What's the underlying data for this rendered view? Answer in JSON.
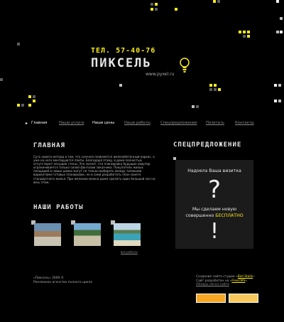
{
  "header": {
    "phone": "ТЕЛ. 57-40-76",
    "brand": "ПИКСЕЛЬ",
    "site": "www.pyxel.ru"
  },
  "nav": {
    "items": [
      {
        "label": "Главная",
        "active": true
      },
      {
        "label": "Наши услуги",
        "active": false
      },
      {
        "label": "Наши цены",
        "active": true
      },
      {
        "label": "Наши работы",
        "active": false
      },
      {
        "label": "Спецпредложение",
        "active": false
      },
      {
        "label": "Почитать",
        "active": false
      },
      {
        "label": "Контакты",
        "active": false
      }
    ]
  },
  "main": {
    "title": "ГЛАВНАЯ",
    "text": "Суть нового метода в том, что сначала появляется железобетонный каркас, а уже на него монтируются плиты. Благодаря этому, в доме полностью отсутствуют несущие стены. Это значит, что планировка будущих квартир ограничивается только силой фантазии заказчика. Покупатели жилых площадей в новых домах могут не только выбирать между типовыми вариантами готовых планировок, но и сами разработать план своего стандартного жилья. При желании можно даже сделать один большой зал на весь этаж."
  },
  "works": {
    "title": "НАШИ РАБОТЫ",
    "all_link": "все работы"
  },
  "special": {
    "title": "СПЕЦПРЕДЛОЖЕНИЕ",
    "box_title": "Надоела   Ваша визитка",
    "question": "?",
    "line1": "Мы сделаем новую",
    "line2_prefix": "совершенно ",
    "line2_highlight": "БЕСПЛАТНО",
    "exclaim": "!"
  },
  "footer": {
    "left_line1": "«Пиксель» 2009 ©",
    "left_line2": "Рекламное агенство полного цикла",
    "right_line1_prefix": "Создание сайта студии «",
    "right_line1_link": "Bell Stalls",
    "right_line1_suffix": "»",
    "right_line2_prefix": "Сайт разработан на «",
    "right_line2_link": "FreeCMS",
    "right_line2_suffix": "»",
    "right_line3": "Обзоры легал сайта",
    "badge1": "",
    "badge2": ""
  },
  "colors": {
    "accent": "#f6e81c",
    "background": "#000000"
  }
}
